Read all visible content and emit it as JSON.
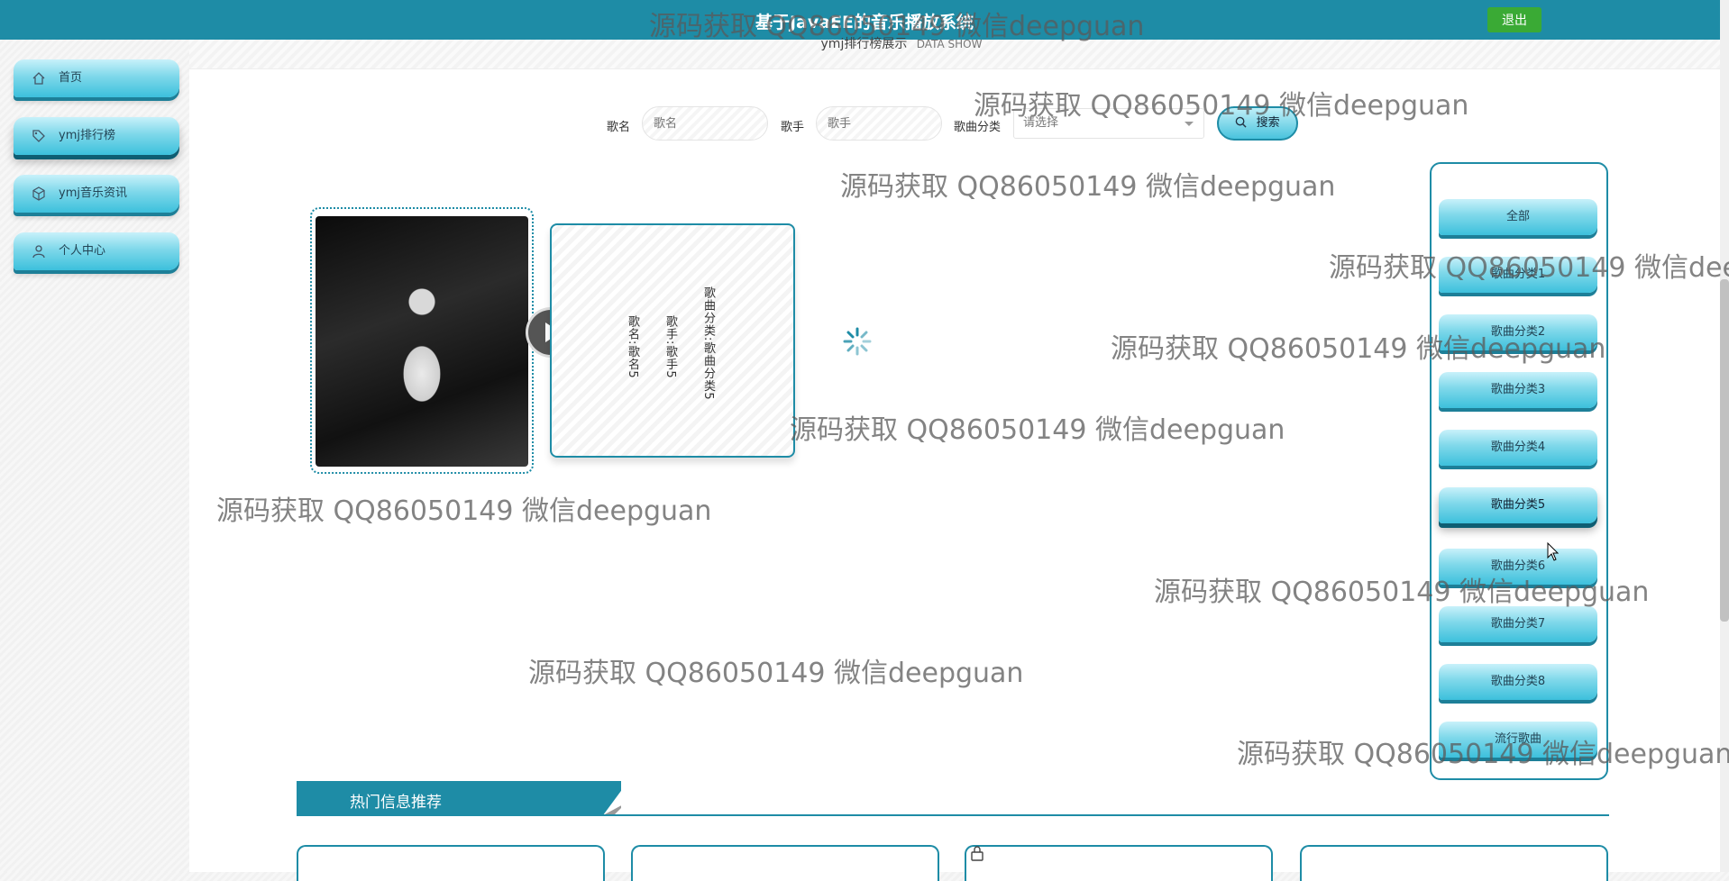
{
  "header": {
    "title": "基于JavaEE的音乐播放系统",
    "logout_label": "退出"
  },
  "sidebar": {
    "items": [
      {
        "label": "首页",
        "icon": "home-icon"
      },
      {
        "label": "ymj排行榜",
        "icon": "tag-icon"
      },
      {
        "label": "ymj音乐资讯",
        "icon": "cube-icon"
      },
      {
        "label": "个人中心",
        "icon": "user-icon"
      }
    ]
  },
  "section": {
    "title": "ymj排行榜展示",
    "subtitle": "DATA SHOW"
  },
  "search": {
    "name_label": "歌名",
    "name_placeholder": "歌名",
    "singer_label": "歌手",
    "singer_placeholder": "歌手",
    "category_label": "歌曲分类",
    "category_placeholder": "请选择",
    "button_label": "搜索"
  },
  "song_card": {
    "name_line": "歌名:歌名5",
    "singer_line": "歌手:歌手5",
    "category_line": "歌曲分类:歌曲分类5"
  },
  "categories": {
    "items": [
      "全部",
      "歌曲分类1",
      "歌曲分类2",
      "歌曲分类3",
      "歌曲分类4",
      "歌曲分类5",
      "歌曲分类6",
      "歌曲分类7",
      "歌曲分类8",
      "流行歌曲"
    ],
    "selected": "歌曲分类5"
  },
  "hot": {
    "title": "热门信息推荐"
  },
  "watermark": {
    "text": "源码获取 QQ86050149 微信deepguan"
  },
  "colors": {
    "primary": "#1e8ca6",
    "logout": "#3aaa35"
  }
}
